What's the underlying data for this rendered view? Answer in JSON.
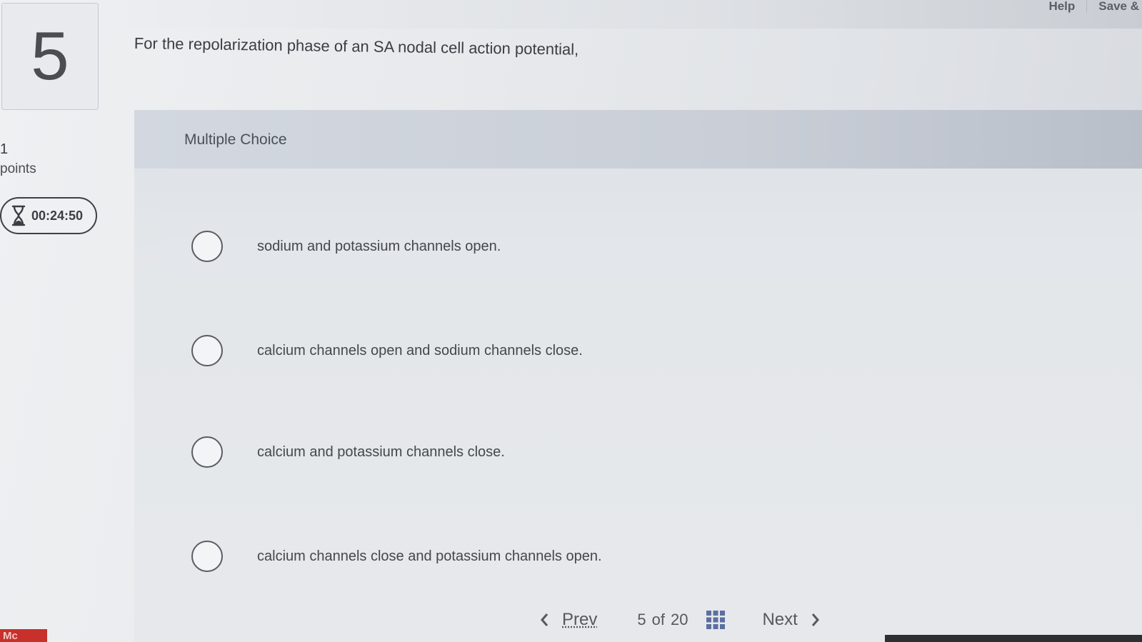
{
  "header": {
    "links": [
      {
        "label": "Help"
      },
      {
        "label": "Save &"
      }
    ]
  },
  "sidebar": {
    "question_number": "5",
    "points_value": "1",
    "points_label": "points",
    "timer": "00:24:50",
    "brand": "Mc"
  },
  "question": {
    "prompt": "For the repolarization phase of an SA nodal cell action potential,",
    "type_label": "Multiple Choice",
    "choices": [
      {
        "label": "sodium and potassium channels open."
      },
      {
        "label": "calcium channels open and sodium channels close."
      },
      {
        "label": "calcium and potassium channels close."
      },
      {
        "label": "calcium channels close and potassium channels open."
      }
    ]
  },
  "pager": {
    "prev_label": "Prev",
    "current": "5",
    "of_label": "of",
    "total": "20",
    "next_label": "Next"
  }
}
